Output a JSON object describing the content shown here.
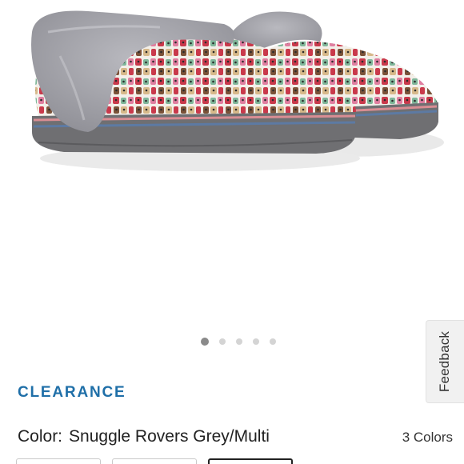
{
  "carousel": {
    "slide_count": 5,
    "active_index": 0
  },
  "feedback": {
    "label": "Feedback"
  },
  "product": {
    "badge": "CLEARANCE",
    "color_label": "Color:",
    "color_value": "Snuggle Rovers Grey/Multi",
    "colors_count": "3 Colors"
  },
  "swatches": {
    "count": 3,
    "selected_index": 2
  },
  "colors": {
    "badge": "#1f6fa8",
    "fur": "#9b9ba1",
    "sole": "#6f6f72",
    "stripe_pink": "#d98d93",
    "stripe_blue": "#5d7aa3",
    "print_red": "#c9394b",
    "print_pink": "#e07ea0",
    "print_green": "#7fb79a",
    "print_brown": "#7b5238",
    "print_tan": "#d7b98a"
  }
}
